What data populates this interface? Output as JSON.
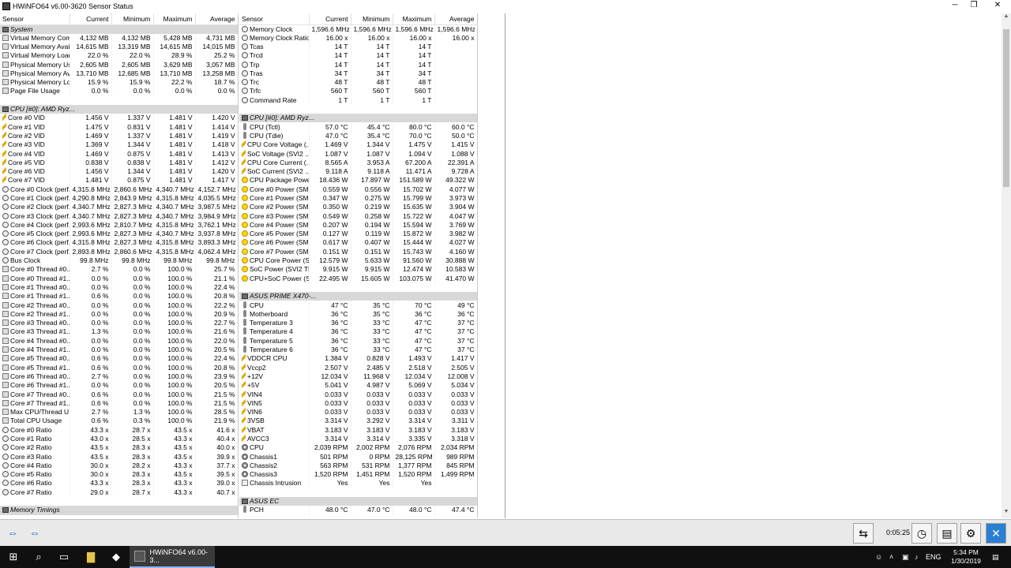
{
  "window": {
    "title": "HWiNFO64 v6.00-3620 Sensor Status",
    "min_icon": "─",
    "max_icon": "❐",
    "close_icon": "✕"
  },
  "columns": {
    "sensor": "Sensor",
    "current": "Current",
    "minimum": "Minimum",
    "maximum": "Maximum",
    "average": "Average"
  },
  "left_rows": [
    {
      "type": "group",
      "name": "System"
    },
    {
      "name": "Virtual Memory Com...",
      "icon": "usage",
      "cur": "4,132 MB",
      "min": "4,132 MB",
      "max": "5,428 MB",
      "avg": "4,731 MB"
    },
    {
      "name": "Virtual Memory Avai...",
      "icon": "usage",
      "cur": "14,615 MB",
      "min": "13,319 MB",
      "max": "14,615 MB",
      "avg": "14,015 MB"
    },
    {
      "name": "Virtual Memory Load",
      "icon": "usage",
      "cur": "22.0 %",
      "min": "22.0 %",
      "max": "28.9 %",
      "avg": "25.2 %"
    },
    {
      "name": "Physical Memory Used",
      "icon": "usage",
      "cur": "2,605 MB",
      "min": "2,605 MB",
      "max": "3,629 MB",
      "avg": "3,057 MB"
    },
    {
      "name": "Physical Memory Av...",
      "icon": "usage",
      "cur": "13,710 MB",
      "min": "12,685 MB",
      "max": "13,710 MB",
      "avg": "13,258 MB"
    },
    {
      "name": "Physical Memory Load",
      "icon": "usage",
      "cur": "15.9 %",
      "min": "15.9 %",
      "max": "22.2 %",
      "avg": "18.7 %"
    },
    {
      "name": "Page File Usage",
      "icon": "usage",
      "cur": "0.0 %",
      "min": "0.0 %",
      "max": "0.0 %",
      "avg": "0.0 %"
    },
    {
      "type": "blank"
    },
    {
      "type": "group",
      "name": "CPU [#0]: AMD Ryz..."
    },
    {
      "name": "Core #0 VID",
      "icon": "volt",
      "cur": "1.456 V",
      "min": "1.337 V",
      "max": "1.481 V",
      "avg": "1.420 V"
    },
    {
      "name": "Core #1 VID",
      "icon": "volt",
      "cur": "1.475 V",
      "min": "0.831 V",
      "max": "1.481 V",
      "avg": "1.414 V"
    },
    {
      "name": "Core #2 VID",
      "icon": "volt",
      "cur": "1.469 V",
      "min": "1.337 V",
      "max": "1.481 V",
      "avg": "1.419 V"
    },
    {
      "name": "Core #3 VID",
      "icon": "volt",
      "cur": "1.369 V",
      "min": "1.344 V",
      "max": "1.481 V",
      "avg": "1.418 V"
    },
    {
      "name": "Core #4 VID",
      "icon": "volt",
      "cur": "1.469 V",
      "min": "0.875 V",
      "max": "1.481 V",
      "avg": "1.413 V"
    },
    {
      "name": "Core #5 VID",
      "icon": "volt",
      "cur": "0.838 V",
      "min": "0.838 V",
      "max": "1.481 V",
      "avg": "1.412 V"
    },
    {
      "name": "Core #6 VID",
      "icon": "volt",
      "cur": "1.456 V",
      "min": "1.344 V",
      "max": "1.481 V",
      "avg": "1.420 V"
    },
    {
      "name": "Core #7 VID",
      "icon": "volt",
      "cur": "1.481 V",
      "min": "0.875 V",
      "max": "1.481 V",
      "avg": "1.417 V"
    },
    {
      "name": "Core #0 Clock (perf...",
      "icon": "clock",
      "cur": "4,315.8 MHz",
      "min": "2,860.6 MHz",
      "max": "4,340.7 MHz",
      "avg": "4,152.7 MHz"
    },
    {
      "name": "Core #1 Clock (perf...",
      "icon": "clock",
      "cur": "4,290.8 MHz",
      "min": "2,843.9 MHz",
      "max": "4,315.8 MHz",
      "avg": "4,035.5 MHz"
    },
    {
      "name": "Core #2 Clock (perf...",
      "icon": "clock",
      "cur": "4,340.7 MHz",
      "min": "2,827.3 MHz",
      "max": "4,340.7 MHz",
      "avg": "3,987.5 MHz"
    },
    {
      "name": "Core #3 Clock (perf...",
      "icon": "clock",
      "cur": "4,340.7 MHz",
      "min": "2,827.3 MHz",
      "max": "4,340.7 MHz",
      "avg": "3,984.9 MHz"
    },
    {
      "name": "Core #4 Clock (perf...",
      "icon": "clock",
      "cur": "2,993.6 MHz",
      "min": "2,810.7 MHz",
      "max": "4,315.8 MHz",
      "avg": "3,762.1 MHz"
    },
    {
      "name": "Core #5 Clock (perf...",
      "icon": "clock",
      "cur": "2,993.6 MHz",
      "min": "2,827.3 MHz",
      "max": "4,340.7 MHz",
      "avg": "3,937.8 MHz"
    },
    {
      "name": "Core #6 Clock (perf...",
      "icon": "clock",
      "cur": "4,315.8 MHz",
      "min": "2,827.3 MHz",
      "max": "4,315.8 MHz",
      "avg": "3,893.3 MHz"
    },
    {
      "name": "Core #7 Clock (perf...",
      "icon": "clock",
      "cur": "2,893.8 MHz",
      "min": "2,860.6 MHz",
      "max": "4,315.8 MHz",
      "avg": "4,062.4 MHz"
    },
    {
      "name": "Bus Clock",
      "icon": "clock",
      "cur": "99.8 MHz",
      "min": "99.8 MHz",
      "max": "99.8 MHz",
      "avg": "99.8 MHz"
    },
    {
      "name": "Core #0 Thread #0...",
      "icon": "usage",
      "cur": "2.7 %",
      "min": "0.0 %",
      "max": "100.0 %",
      "avg": "25.7 %"
    },
    {
      "name": "Core #0 Thread #1...",
      "icon": "usage",
      "cur": "0.0 %",
      "min": "0.0 %",
      "max": "100.0 %",
      "avg": "21.1 %"
    },
    {
      "name": "Core #1 Thread #0...",
      "icon": "usage",
      "cur": "0.0 %",
      "min": "0.0 %",
      "max": "100.0 %",
      "avg": "22.4 %"
    },
    {
      "name": "Core #1 Thread #1...",
      "icon": "usage",
      "cur": "0.6 %",
      "min": "0.0 %",
      "max": "100.0 %",
      "avg": "20.8 %"
    },
    {
      "name": "Core #2 Thread #0...",
      "icon": "usage",
      "cur": "0.0 %",
      "min": "0.0 %",
      "max": "100.0 %",
      "avg": "22.2 %"
    },
    {
      "name": "Core #2 Thread #1...",
      "icon": "usage",
      "cur": "0.0 %",
      "min": "0.0 %",
      "max": "100.0 %",
      "avg": "20.9 %"
    },
    {
      "name": "Core #3 Thread #0...",
      "icon": "usage",
      "cur": "0.0 %",
      "min": "0.0 %",
      "max": "100.0 %",
      "avg": "22.7 %"
    },
    {
      "name": "Core #3 Thread #1...",
      "icon": "usage",
      "cur": "1.3 %",
      "min": "0.0 %",
      "max": "100.0 %",
      "avg": "21.6 %"
    },
    {
      "name": "Core #4 Thread #0...",
      "icon": "usage",
      "cur": "0.0 %",
      "min": "0.0 %",
      "max": "100.0 %",
      "avg": "22.0 %"
    },
    {
      "name": "Core #4 Thread #1...",
      "icon": "usage",
      "cur": "0.0 %",
      "min": "0.0 %",
      "max": "100.0 %",
      "avg": "20.5 %"
    },
    {
      "name": "Core #5 Thread #0...",
      "icon": "usage",
      "cur": "0.6 %",
      "min": "0.0 %",
      "max": "100.0 %",
      "avg": "22.4 %"
    },
    {
      "name": "Core #5 Thread #1...",
      "icon": "usage",
      "cur": "0.6 %",
      "min": "0.0 %",
      "max": "100.0 %",
      "avg": "20.8 %"
    },
    {
      "name": "Core #6 Thread #0...",
      "icon": "usage",
      "cur": "2.7 %",
      "min": "0.0 %",
      "max": "100.0 %",
      "avg": "23.9 %"
    },
    {
      "name": "Core #6 Thread #1...",
      "icon": "usage",
      "cur": "0.0 %",
      "min": "0.0 %",
      "max": "100.0 %",
      "avg": "20.5 %"
    },
    {
      "name": "Core #7 Thread #0...",
      "icon": "usage",
      "cur": "0.6 %",
      "min": "0.0 %",
      "max": "100.0 %",
      "avg": "21.5 %"
    },
    {
      "name": "Core #7 Thread #1...",
      "icon": "usage",
      "cur": "0.6 %",
      "min": "0.0 %",
      "max": "100.0 %",
      "avg": "21.5 %"
    },
    {
      "name": "Max CPU/Thread U...",
      "icon": "usage",
      "cur": "2.7 %",
      "min": "1.3 %",
      "max": "100.0 %",
      "avg": "28.5 %"
    },
    {
      "name": "Total CPU Usage",
      "icon": "usage",
      "cur": "0.6 %",
      "min": "0.3 %",
      "max": "100.0 %",
      "avg": "21.9 %"
    },
    {
      "name": "Core #0 Ratio",
      "icon": "clock",
      "cur": "43.3 x",
      "min": "28.7 x",
      "max": "43.5 x",
      "avg": "41.6 x"
    },
    {
      "name": "Core #1 Ratio",
      "icon": "clock",
      "cur": "43.0 x",
      "min": "28.5 x",
      "max": "43.3 x",
      "avg": "40.4 x"
    },
    {
      "name": "Core #2 Ratio",
      "icon": "clock",
      "cur": "43.5 x",
      "min": "28.3 x",
      "max": "43.5 x",
      "avg": "40.0 x"
    },
    {
      "name": "Core #3 Ratio",
      "icon": "clock",
      "cur": "43.5 x",
      "min": "28.3 x",
      "max": "43.5 x",
      "avg": "39.9 x"
    },
    {
      "name": "Core #4 Ratio",
      "icon": "clock",
      "cur": "30.0 x",
      "min": "28.2 x",
      "max": "43.3 x",
      "avg": "37.7 x"
    },
    {
      "name": "Core #5 Ratio",
      "icon": "clock",
      "cur": "30.0 x",
      "min": "28.3 x",
      "max": "43.5 x",
      "avg": "39.5 x"
    },
    {
      "name": "Core #6 Ratio",
      "icon": "clock",
      "cur": "43.3 x",
      "min": "28.3 x",
      "max": "43.3 x",
      "avg": "39.0 x"
    },
    {
      "name": "Core #7 Ratio",
      "icon": "clock",
      "cur": "29.0 x",
      "min": "28.7 x",
      "max": "43.3 x",
      "avg": "40.7 x"
    },
    {
      "type": "blank"
    },
    {
      "type": "group",
      "name": "Memory Timings"
    }
  ],
  "right_rows": [
    {
      "name": "Memory Clock",
      "icon": "clock",
      "cur": "1,596.6 MHz",
      "min": "1,596.6 MHz",
      "max": "1,596.6 MHz",
      "avg": "1,596.6 MHz"
    },
    {
      "name": "Memory Clock Ratio",
      "icon": "clock",
      "cur": "16.00 x",
      "min": "16.00 x",
      "max": "16.00 x",
      "avg": "16.00 x"
    },
    {
      "name": "Tcas",
      "icon": "clock",
      "cur": "14 T",
      "min": "14 T",
      "max": "14 T",
      "avg": ""
    },
    {
      "name": "Trcd",
      "icon": "clock",
      "cur": "14 T",
      "min": "14 T",
      "max": "14 T",
      "avg": ""
    },
    {
      "name": "Trp",
      "icon": "clock",
      "cur": "14 T",
      "min": "14 T",
      "max": "14 T",
      "avg": ""
    },
    {
      "name": "Tras",
      "icon": "clock",
      "cur": "34 T",
      "min": "34 T",
      "max": "34 T",
      "avg": ""
    },
    {
      "name": "Trc",
      "icon": "clock",
      "cur": "48 T",
      "min": "48 T",
      "max": "48 T",
      "avg": ""
    },
    {
      "name": "Trfc",
      "icon": "clock",
      "cur": "560 T",
      "min": "560 T",
      "max": "560 T",
      "avg": ""
    },
    {
      "name": "Command Rate",
      "icon": "clock",
      "cur": "1 T",
      "min": "1 T",
      "max": "1 T",
      "avg": ""
    },
    {
      "type": "blank"
    },
    {
      "type": "group",
      "name": "CPU [#0]: AMD Ryz..."
    },
    {
      "name": "CPU (Tctl)",
      "icon": "temp",
      "cur": "57.0 °C",
      "min": "45.4 °C",
      "max": "80.0 °C",
      "avg": "60.0 °C"
    },
    {
      "name": "CPU (Tdie)",
      "icon": "temp",
      "cur": "47.0 °C",
      "min": "35.4 °C",
      "max": "70.0 °C",
      "avg": "50.0 °C"
    },
    {
      "name": "CPU Core Voltage (...",
      "icon": "volt",
      "cur": "1.469 V",
      "min": "1.344 V",
      "max": "1.475 V",
      "avg": "1.415 V"
    },
    {
      "name": "SoC Voltage (SVI2 ...",
      "icon": "volt",
      "cur": "1.087 V",
      "min": "1.087 V",
      "max": "1.094 V",
      "avg": "1.088 V"
    },
    {
      "name": "CPU Core Current (...",
      "icon": "volt",
      "cur": "8.565 A",
      "min": "3.953 A",
      "max": "67.200 A",
      "avg": "22.391 A"
    },
    {
      "name": "SoC Current (SVI2 ...",
      "icon": "volt",
      "cur": "9.118 A",
      "min": "9.118 A",
      "max": "11.471 A",
      "avg": "9.728 A"
    },
    {
      "name": "CPU Package Powe...",
      "icon": "power",
      "cur": "18.436 W",
      "min": "17.897 W",
      "max": "151.589 W",
      "avg": "49.322 W"
    },
    {
      "name": "Core #0 Power (SMU)",
      "icon": "power",
      "cur": "0.559 W",
      "min": "0.556 W",
      "max": "15.702 W",
      "avg": "4.077 W"
    },
    {
      "name": "Core #1 Power (SMU)",
      "icon": "power",
      "cur": "0.347 W",
      "min": "0.275 W",
      "max": "15.799 W",
      "avg": "3.973 W"
    },
    {
      "name": "Core #2 Power (SMU)",
      "icon": "power",
      "cur": "0.350 W",
      "min": "0.219 W",
      "max": "15.635 W",
      "avg": "3.904 W"
    },
    {
      "name": "Core #3 Power (SMU)",
      "icon": "power",
      "cur": "0.549 W",
      "min": "0.258 W",
      "max": "15.722 W",
      "avg": "4.047 W"
    },
    {
      "name": "Core #4 Power (SMU)",
      "icon": "power",
      "cur": "0.207 W",
      "min": "0.194 W",
      "max": "15.594 W",
      "avg": "3.769 W"
    },
    {
      "name": "Core #5 Power (SMU)",
      "icon": "power",
      "cur": "0.127 W",
      "min": "0.119 W",
      "max": "15.872 W",
      "avg": "3.982 W"
    },
    {
      "name": "Core #6 Power (SMU)",
      "icon": "power",
      "cur": "0.617 W",
      "min": "0.407 W",
      "max": "15.444 W",
      "avg": "4.027 W"
    },
    {
      "name": "Core #7 Power (SMU)",
      "icon": "power",
      "cur": "0.151 W",
      "min": "0.151 W",
      "max": "15.743 W",
      "avg": "4.160 W"
    },
    {
      "name": "CPU Core Power (S...",
      "icon": "power",
      "cur": "12.579 W",
      "min": "5.633 W",
      "max": "91.560 W",
      "avg": "30.888 W"
    },
    {
      "name": "SoC Power (SVI2 TFN)",
      "icon": "power",
      "cur": "9.915 W",
      "min": "9.915 W",
      "max": "12.474 W",
      "avg": "10.583 W"
    },
    {
      "name": "CPU+SoC Power (S...",
      "icon": "power",
      "cur": "22.495 W",
      "min": "15.605 W",
      "max": "103.075 W",
      "avg": "41.470 W"
    },
    {
      "type": "blank"
    },
    {
      "type": "group",
      "name": "ASUS PRIME X470-..."
    },
    {
      "name": "CPU",
      "icon": "temp",
      "cur": "47 °C",
      "min": "35 °C",
      "max": "70 °C",
      "avg": "49 °C"
    },
    {
      "name": "Motherboard",
      "icon": "temp",
      "cur": "36 °C",
      "min": "35 °C",
      "max": "36 °C",
      "avg": "36 °C"
    },
    {
      "name": "Temperature 3",
      "icon": "temp",
      "cur": "36 °C",
      "min": "33 °C",
      "max": "47 °C",
      "avg": "37 °C"
    },
    {
      "name": "Temperature 4",
      "icon": "temp",
      "cur": "36 °C",
      "min": "33 °C",
      "max": "47 °C",
      "avg": "37 °C"
    },
    {
      "name": "Temperature 5",
      "icon": "temp",
      "cur": "36 °C",
      "min": "33 °C",
      "max": "47 °C",
      "avg": "37 °C"
    },
    {
      "name": "Temperature 6",
      "icon": "temp",
      "cur": "36 °C",
      "min": "33 °C",
      "max": "47 °C",
      "avg": "37 °C"
    },
    {
      "name": "VDDCR CPU",
      "icon": "volt",
      "cur": "1.384 V",
      "min": "0.828 V",
      "max": "1.493 V",
      "avg": "1.417 V"
    },
    {
      "name": "Vccp2",
      "icon": "volt",
      "cur": "2.507 V",
      "min": "2.485 V",
      "max": "2.518 V",
      "avg": "2.505 V"
    },
    {
      "name": "+12V",
      "icon": "volt",
      "cur": "12.034 V",
      "min": "11.968 V",
      "max": "12.034 V",
      "avg": "12.008 V"
    },
    {
      "name": "+5V",
      "icon": "volt",
      "cur": "5.041 V",
      "min": "4.987 V",
      "max": "5.069 V",
      "avg": "5.034 V"
    },
    {
      "name": "VIN4",
      "icon": "volt",
      "cur": "0.033 V",
      "min": "0.033 V",
      "max": "0.033 V",
      "avg": "0.033 V"
    },
    {
      "name": "VIN5",
      "icon": "volt",
      "cur": "0.033 V",
      "min": "0.033 V",
      "max": "0.033 V",
      "avg": "0.033 V"
    },
    {
      "name": "VIN6",
      "icon": "volt",
      "cur": "0.033 V",
      "min": "0.033 V",
      "max": "0.033 V",
      "avg": "0.033 V"
    },
    {
      "name": "3VSB",
      "icon": "volt",
      "cur": "3.314 V",
      "min": "3.292 V",
      "max": "3.314 V",
      "avg": "3.311 V"
    },
    {
      "name": "VBAT",
      "icon": "volt",
      "cur": "3.183 V",
      "min": "3.183 V",
      "max": "3.183 V",
      "avg": "3.183 V"
    },
    {
      "name": "AVCC3",
      "icon": "volt",
      "cur": "3.314 V",
      "min": "3.314 V",
      "max": "3.335 V",
      "avg": "3.318 V"
    },
    {
      "name": "CPU",
      "icon": "fan",
      "cur": "2,039 RPM",
      "min": "2,002 RPM",
      "max": "2,076 RPM",
      "avg": "2,034 RPM"
    },
    {
      "name": "Chassis1",
      "icon": "fan",
      "cur": "501 RPM",
      "min": "0 RPM",
      "max": "28,125 RPM",
      "avg": "989 RPM"
    },
    {
      "name": "Chassis2",
      "icon": "fan",
      "cur": "563 RPM",
      "min": "531 RPM",
      "max": "1,377 RPM",
      "avg": "845 RPM"
    },
    {
      "name": "Chassis3",
      "icon": "fan",
      "cur": "1,520 RPM",
      "min": "1,451 RPM",
      "max": "1,520 RPM",
      "avg": "1,499 RPM"
    },
    {
      "name": "Chassis Intrusion",
      "icon": "other",
      "cur": "Yes",
      "min": "Yes",
      "max": "Yes",
      "avg": ""
    },
    {
      "type": "blank"
    },
    {
      "type": "group",
      "name": "ASUS EC"
    },
    {
      "name": "PCH",
      "icon": "temp",
      "cur": "48.0 °C",
      "min": "47.0 °C",
      "max": "48.0 °C",
      "avg": "47.4 °C"
    }
  ],
  "statusbar": {
    "elapsed": "0:05:25"
  },
  "taskbar": {
    "app_label": "HWiNFO64 v6.00-3...",
    "lang": "ENG",
    "time": "5:34 PM",
    "date": "1/30/2019"
  }
}
